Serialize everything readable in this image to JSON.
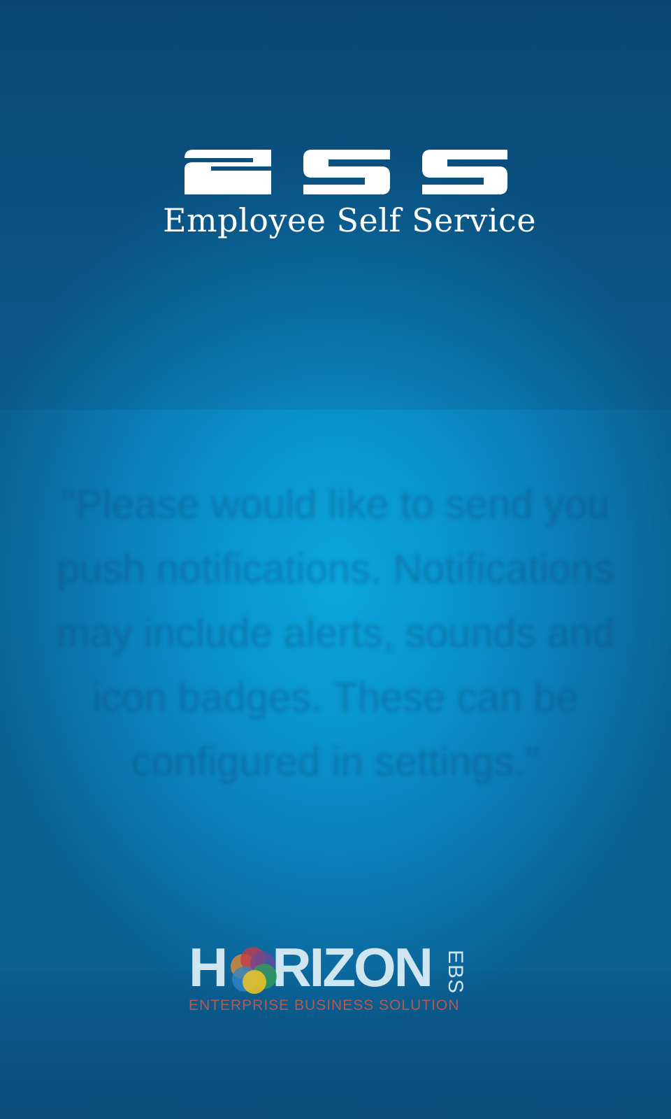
{
  "app": {
    "logo_text": "ESS",
    "subtitle": "Employee Self Service"
  },
  "notice": {
    "text": "\"Please would like to send you push notifications. Notifications may include alerts, sounds and icon badges. These can be configured in settings.\""
  },
  "footer_logo": {
    "wordmark_left": "H",
    "wordmark_right": "RIZON",
    "suffix": "EBS",
    "tagline": "ENTERPRISE BUSINESS SOLUTION"
  },
  "colors": {
    "background_center": "#0aa6dc",
    "background_edge": "#0b5f92",
    "text_white": "#ffffff",
    "tagline_red": "#b6594f",
    "circle_orange": "#d98a3a",
    "circle_red": "#c23c4a",
    "circle_purple": "#6a4a9a",
    "circle_green": "#2e9e5a",
    "circle_blue": "#2f86c6",
    "circle_yellow": "#e8c12a"
  }
}
